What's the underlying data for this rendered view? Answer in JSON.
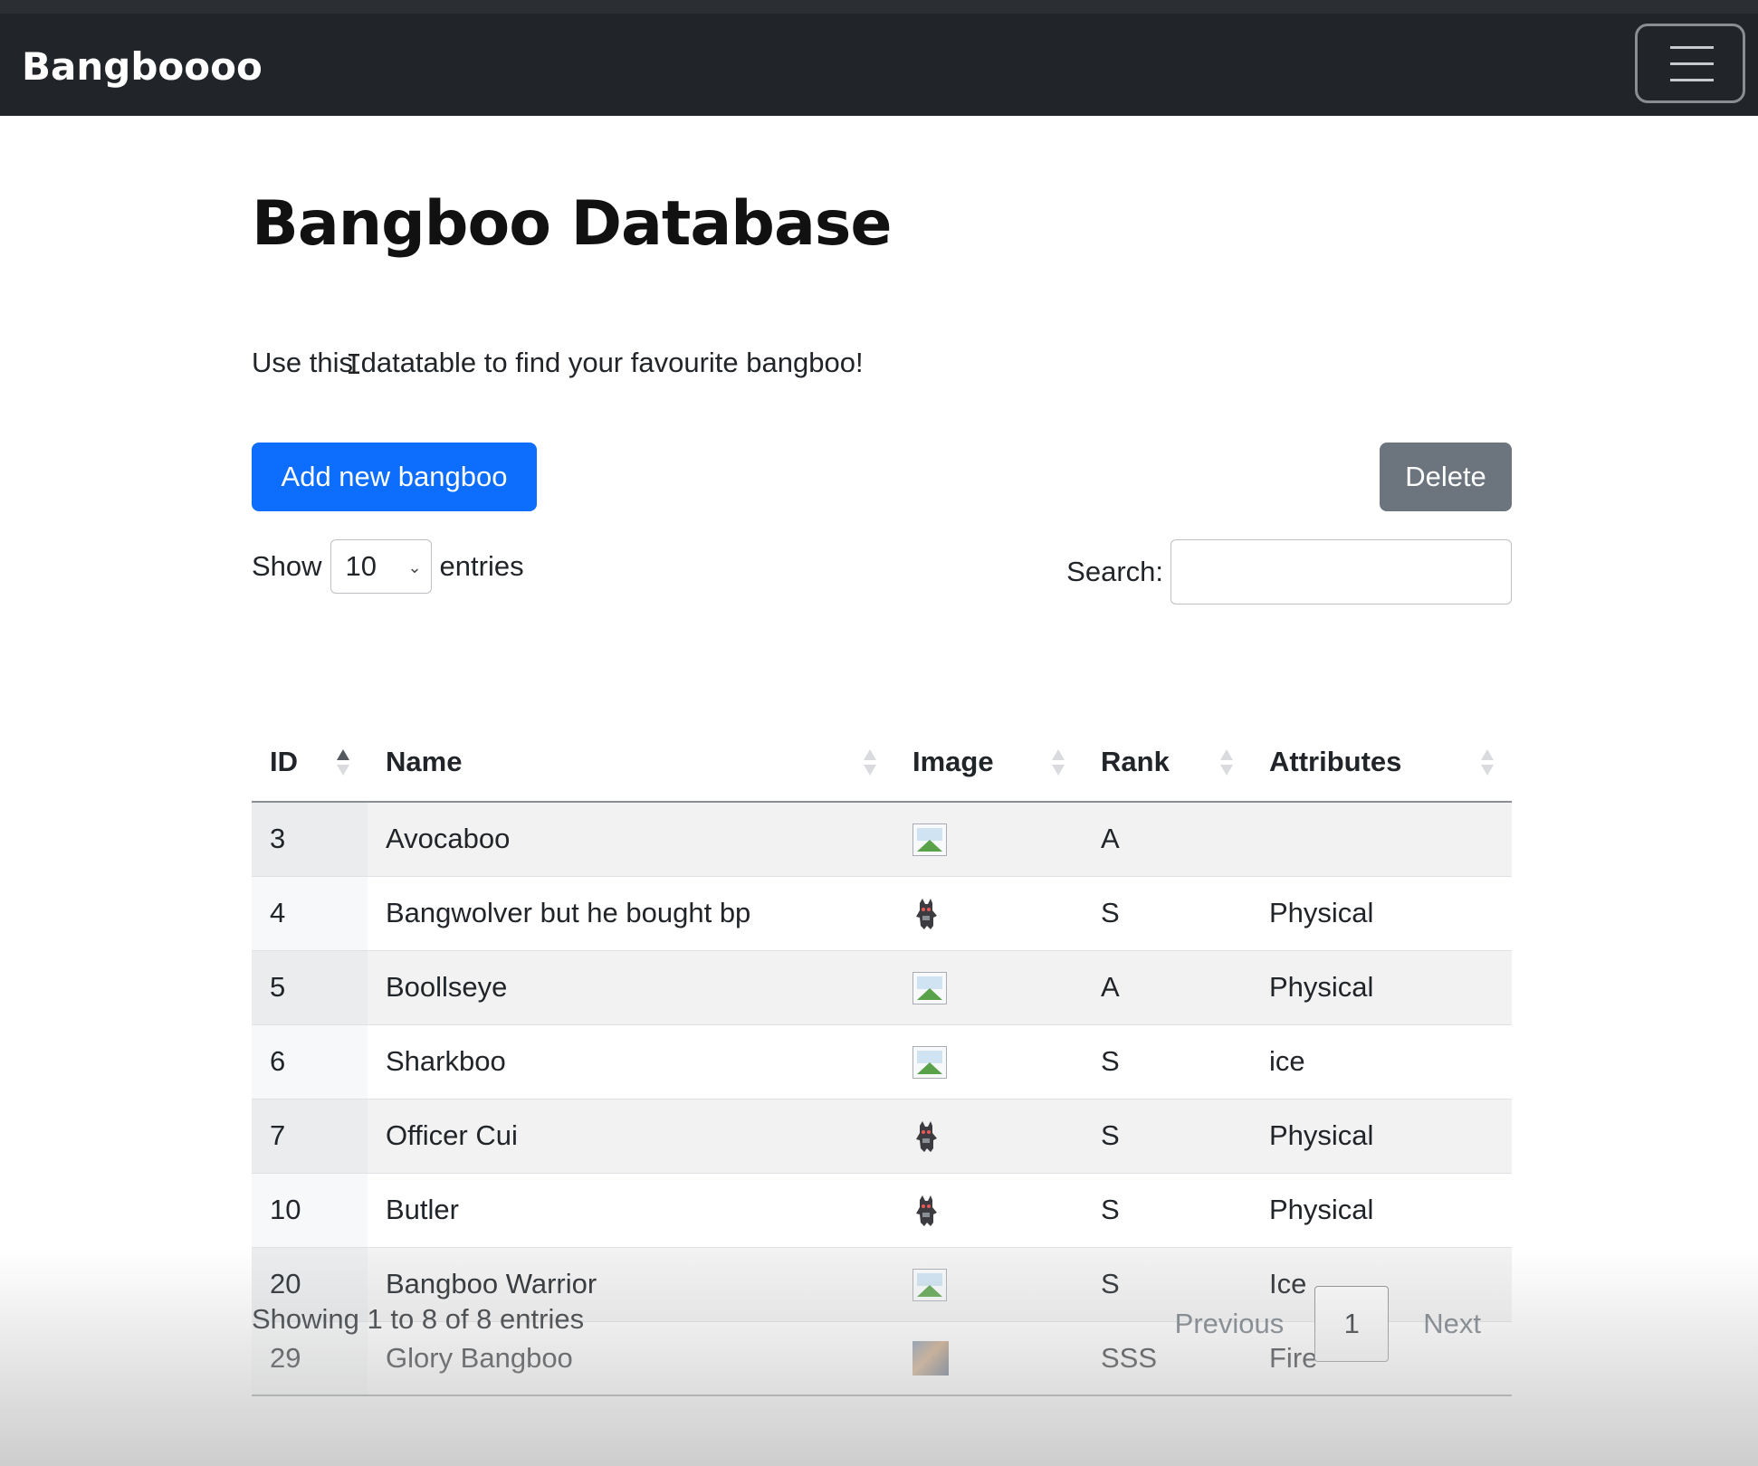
{
  "navbar": {
    "brand": "Bangboooo"
  },
  "page": {
    "title": "Bangboo Database",
    "lead": "Use this datatable to find your favourite bangboo!"
  },
  "actions": {
    "add_label": "Add new bangboo",
    "delete_label": "Delete",
    "add_color": "#0d6efd",
    "delete_color": "#6c757d"
  },
  "length": {
    "show_label": "Show",
    "selected": "10",
    "entries_label": "entries"
  },
  "search": {
    "label": "Search:",
    "value": ""
  },
  "table": {
    "columns": [
      "ID",
      "Name",
      "Image",
      "Rank",
      "Attributes"
    ],
    "sorted_column": "ID",
    "sort_direction": "ascending",
    "rows": [
      {
        "id": "3",
        "name": "Avocaboo",
        "image": "broken-image-icon",
        "rank": "A",
        "attributes": ""
      },
      {
        "id": "4",
        "name": "Bangwolver but he bought bp",
        "image": "bangboo-character-icon",
        "rank": "S",
        "attributes": "Physical"
      },
      {
        "id": "5",
        "name": "Boollseye",
        "image": "broken-image-icon",
        "rank": "A",
        "attributes": "Physical"
      },
      {
        "id": "6",
        "name": "Sharkboo",
        "image": "broken-image-icon",
        "rank": "S",
        "attributes": "ice"
      },
      {
        "id": "7",
        "name": "Officer Cui",
        "image": "bangboo-character-icon",
        "rank": "S",
        "attributes": "Physical"
      },
      {
        "id": "10",
        "name": "Butler",
        "image": "bangboo-character-icon",
        "rank": "S",
        "attributes": "Physical"
      },
      {
        "id": "20",
        "name": "Bangboo Warrior",
        "image": "broken-image-icon",
        "rank": "S",
        "attributes": "Ice"
      },
      {
        "id": "29",
        "name": "Glory Bangboo",
        "image": "photo-thumbnail-icon",
        "rank": "SSS",
        "attributes": "Fire"
      }
    ]
  },
  "footer": {
    "info": "Showing 1 to 8 of 8 entries",
    "previous": "Previous",
    "current_page": "1",
    "next": "Next"
  }
}
